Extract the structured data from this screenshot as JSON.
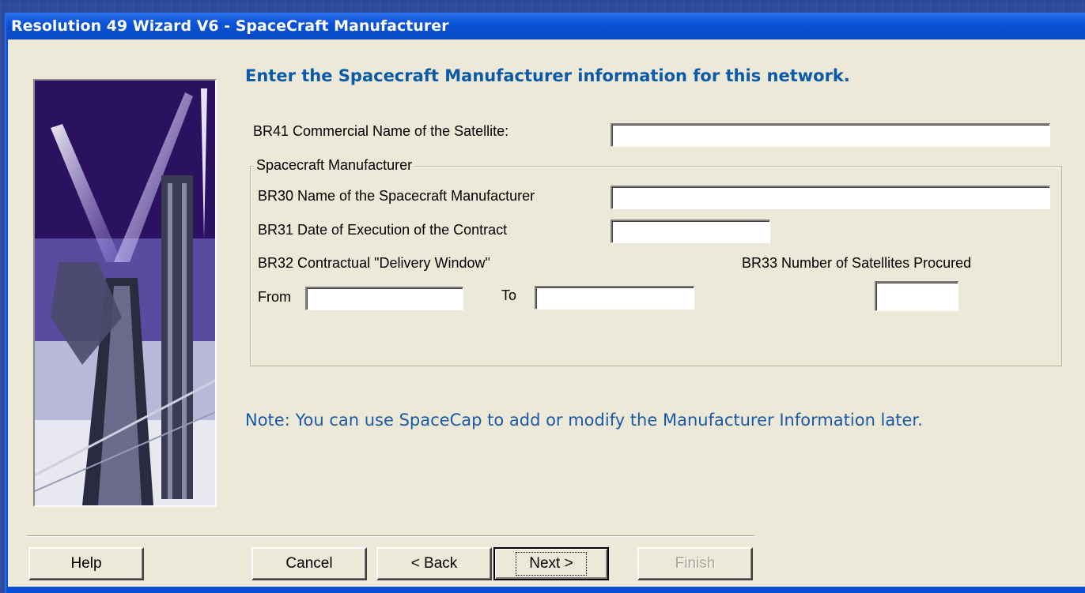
{
  "window": {
    "title": "Resolution 49 Wizard V6 - SpaceCraft Manufacturer"
  },
  "heading": "Enter the Spacecraft Manufacturer information for this network.",
  "fields": {
    "br41_label": "BR41  Commercial Name of the Satellite:",
    "br41_value": "",
    "group_label": "Spacecraft Manufacturer",
    "br30_label": "BR30  Name of the Spacecraft Manufacturer",
    "br30_value": "",
    "br31_label": "BR31  Date of Execution of the Contract",
    "br31_value": "",
    "br32_label": "BR32  Contractual \"Delivery Window\"",
    "from_label": "From",
    "from_value": "",
    "to_label": "To",
    "to_value": "",
    "br33_label": "BR33  Number of Satellites Procured",
    "br33_value": ""
  },
  "note": "Note:  You can use SpaceCap to add or modify the Manufacturer Information later.",
  "buttons": {
    "help": "Help",
    "cancel": "Cancel",
    "back": "< Back",
    "next": "Next >",
    "finish": "Finish"
  },
  "colors": {
    "title_bar": "#0a52d8",
    "dialog_bg": "#ece9d8",
    "heading_text": "#0a5aa8",
    "note_text": "#1a5aa8"
  }
}
